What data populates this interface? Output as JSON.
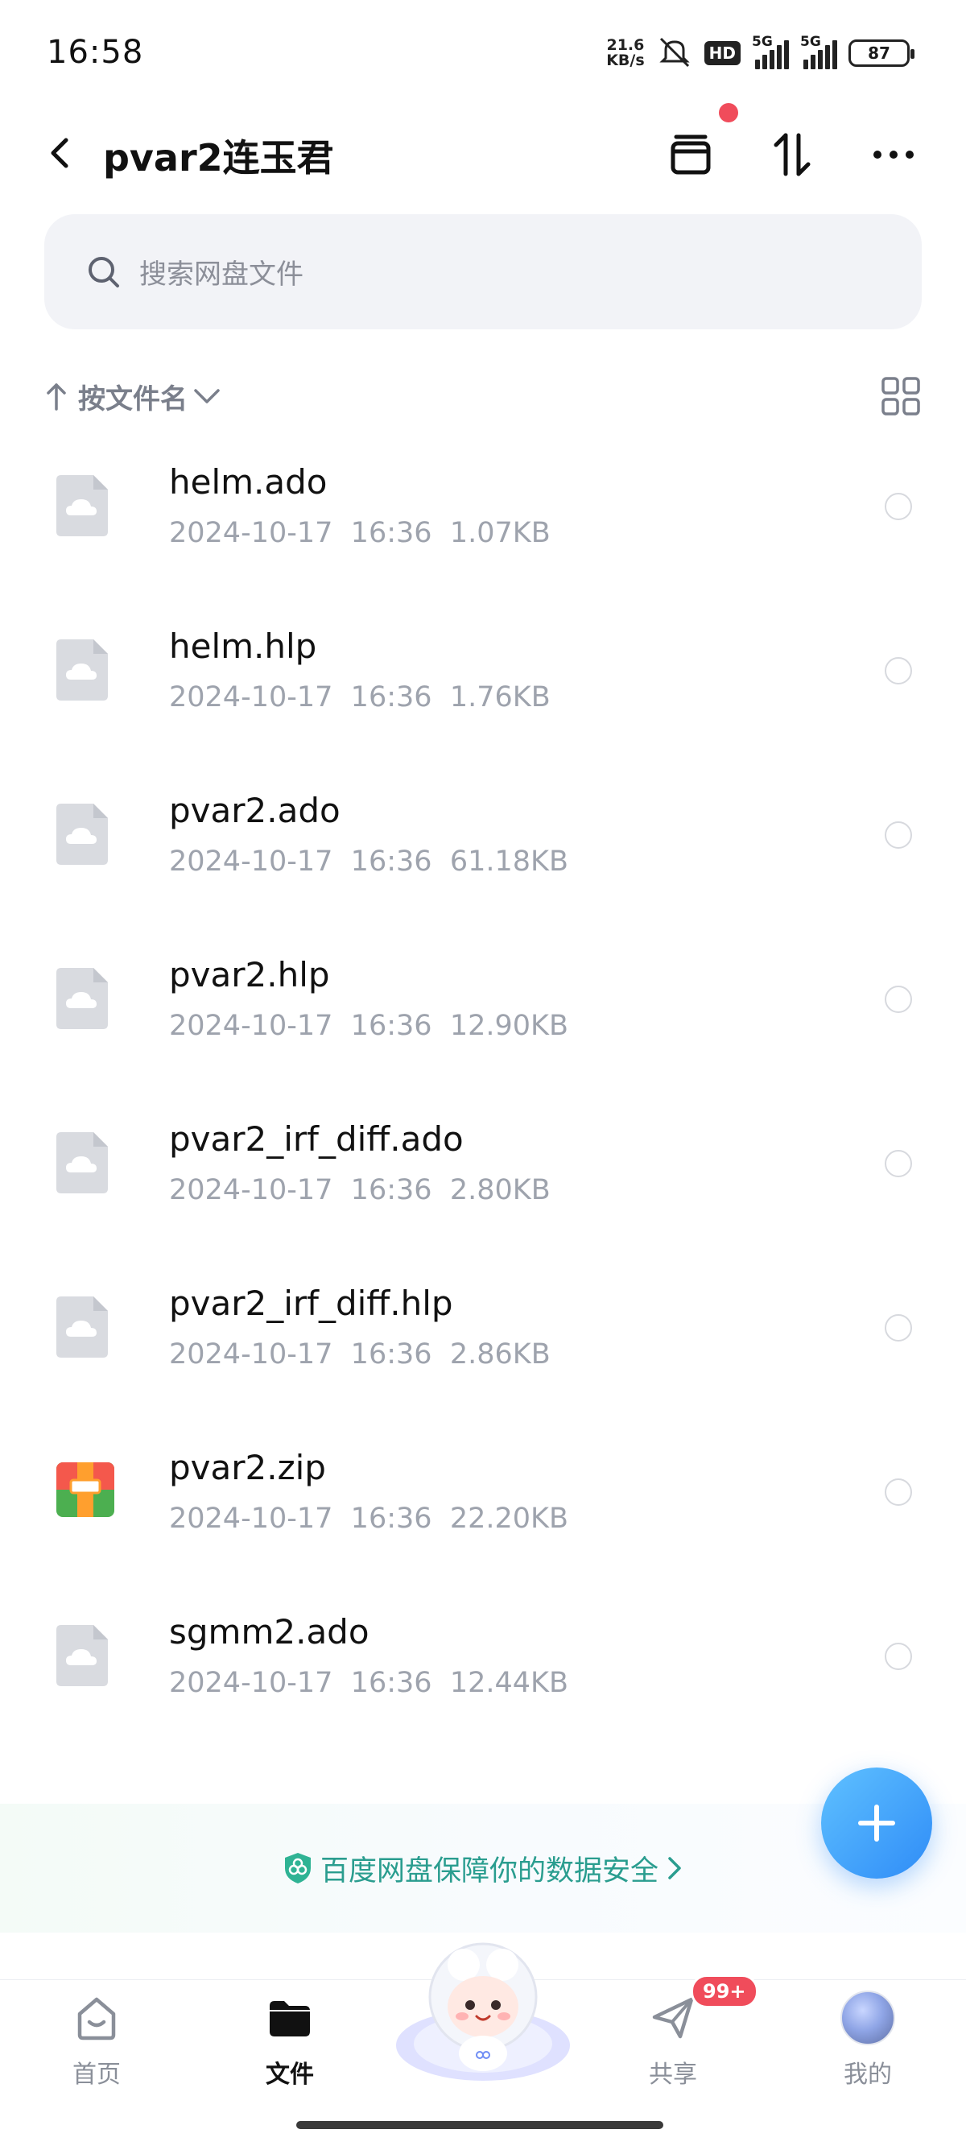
{
  "status_bar": {
    "time": "16:58",
    "net_speed_value": "21.6",
    "net_speed_unit": "KB/s",
    "hd_label": "HD",
    "signal_1_label": "5G",
    "signal_2_label": "5G",
    "battery": "87"
  },
  "header": {
    "title": "pvar2连玉君"
  },
  "search": {
    "placeholder": "搜索网盘文件"
  },
  "sort": {
    "label": "按文件名"
  },
  "files": [
    {
      "name": "helm.ado",
      "date": "2024-10-17",
      "time": "16:36",
      "size": "1.07KB",
      "type": "file"
    },
    {
      "name": "helm.hlp",
      "date": "2024-10-17",
      "time": "16:36",
      "size": "1.76KB",
      "type": "file"
    },
    {
      "name": "pvar2.ado",
      "date": "2024-10-17",
      "time": "16:36",
      "size": "61.18KB",
      "type": "file"
    },
    {
      "name": "pvar2.hlp",
      "date": "2024-10-17",
      "time": "16:36",
      "size": "12.90KB",
      "type": "file"
    },
    {
      "name": "pvar2_irf_diff.ado",
      "date": "2024-10-17",
      "time": "16:36",
      "size": "2.80KB",
      "type": "file"
    },
    {
      "name": "pvar2_irf_diff.hlp",
      "date": "2024-10-17",
      "time": "16:36",
      "size": "2.86KB",
      "type": "file"
    },
    {
      "name": "pvar2.zip",
      "date": "2024-10-17",
      "time": "16:36",
      "size": "22.20KB",
      "type": "zip"
    },
    {
      "name": "sgmm2.ado",
      "date": "2024-10-17",
      "time": "16:36",
      "size": "12.44KB",
      "type": "file"
    }
  ],
  "security_banner": {
    "text": "百度网盘保障你的数据安全"
  },
  "tabs": {
    "home": "首页",
    "files": "文件",
    "share": "共享",
    "share_badge": "99+",
    "me": "我的"
  },
  "colors": {
    "accent": "#2f8cf7",
    "badge": "#f04c5b",
    "security": "#2a9d8f"
  }
}
